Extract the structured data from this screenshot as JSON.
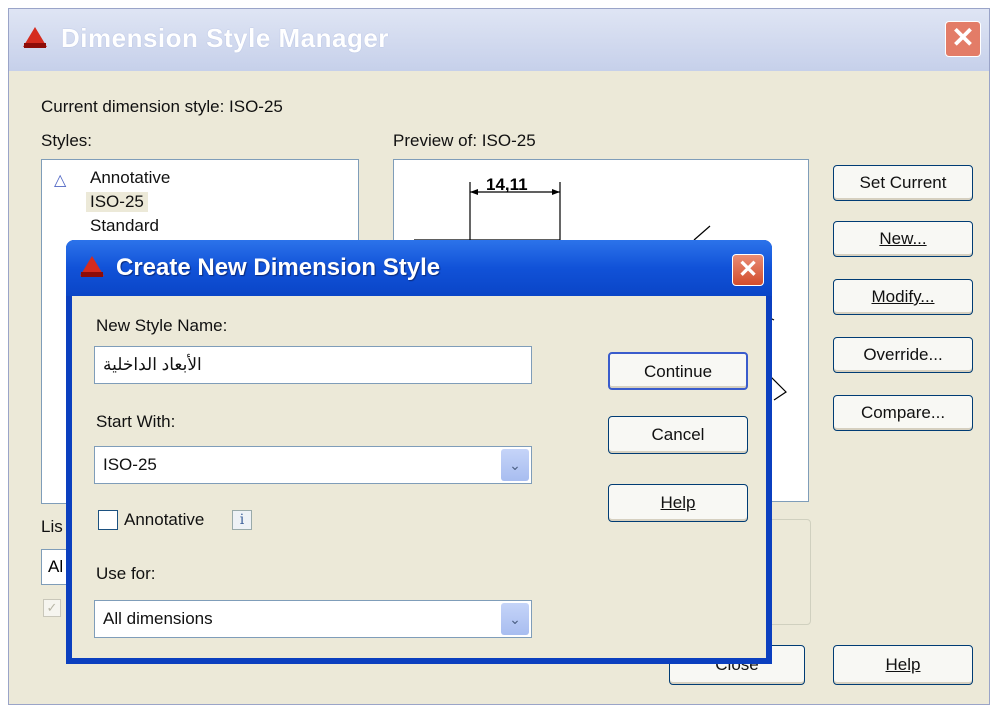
{
  "manager": {
    "title": "Dimension Style Manager",
    "current_style": "Current dimension style: ISO-25",
    "styles_label": "Styles:",
    "styles": [
      "Annotative",
      "ISO-25",
      "Standard"
    ],
    "preview_label": "Preview of: ISO-25",
    "preview_dimension": "14,11",
    "buttons": {
      "set_current": "Set Current",
      "new": "New...",
      "modify": "Modify...",
      "override": "Override...",
      "compare": "Compare...",
      "close": "Close",
      "help": "Help"
    },
    "list_label_partial": "Lis",
    "list_value_partial": "Al"
  },
  "dialog": {
    "title": "Create New Dimension Style",
    "new_style_name_label": "New Style Name:",
    "new_style_name_value": "الأبعاد الداخلية",
    "start_with_label": "Start With:",
    "start_with_value": "ISO-25",
    "annotative_label": "Annotative",
    "use_for_label": "Use for:",
    "use_for_value": "All dimensions",
    "buttons": {
      "continue": "Continue",
      "cancel": "Cancel",
      "help": "Help"
    }
  },
  "icons": {
    "app": "autocad-logo-icon",
    "close": "close-icon",
    "annotative": "annotative-scale-icon",
    "info": "info-icon",
    "dropdown": "chevron-down-icon"
  },
  "colors": {
    "dialog_face": "#ece9d8",
    "xp_title_blue": "#0b3fbf",
    "close_red": "#d24d2d"
  }
}
